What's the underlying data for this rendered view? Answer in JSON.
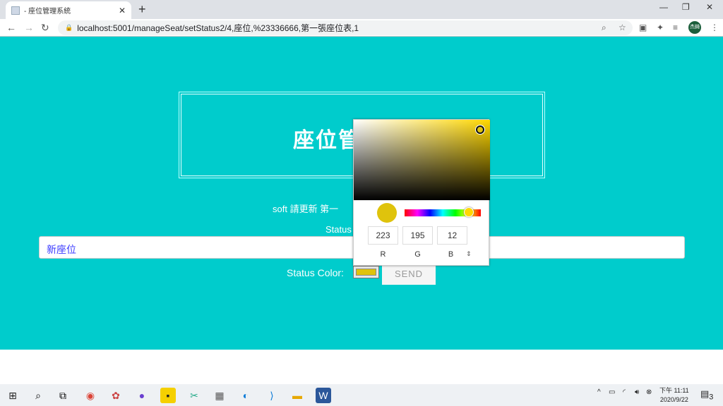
{
  "browser": {
    "tab_title": "- 座位管理系統",
    "url": "localhost:5001/manageSeat/setStatus2/4,座位,%23336666,第一張座位表,1",
    "avatar": "杰錡"
  },
  "page": {
    "title_visible": "座位管",
    "subtitle_visible": "soft 請更新 第一",
    "status_label_visible": "Status",
    "status_input_value": "新座位",
    "color_label": "Status Color:",
    "send_label": "SEND",
    "selected_color": "#dfc30c",
    "bg_color": "#00cccc"
  },
  "picker": {
    "r": "223",
    "g": "195",
    "b": "12",
    "r_label": "R",
    "g_label": "G",
    "b_label": "B",
    "hue_percent": 86
  },
  "taskbar": {
    "time": "下午 11:11",
    "date": "2020/9/22",
    "notifications": "3"
  }
}
